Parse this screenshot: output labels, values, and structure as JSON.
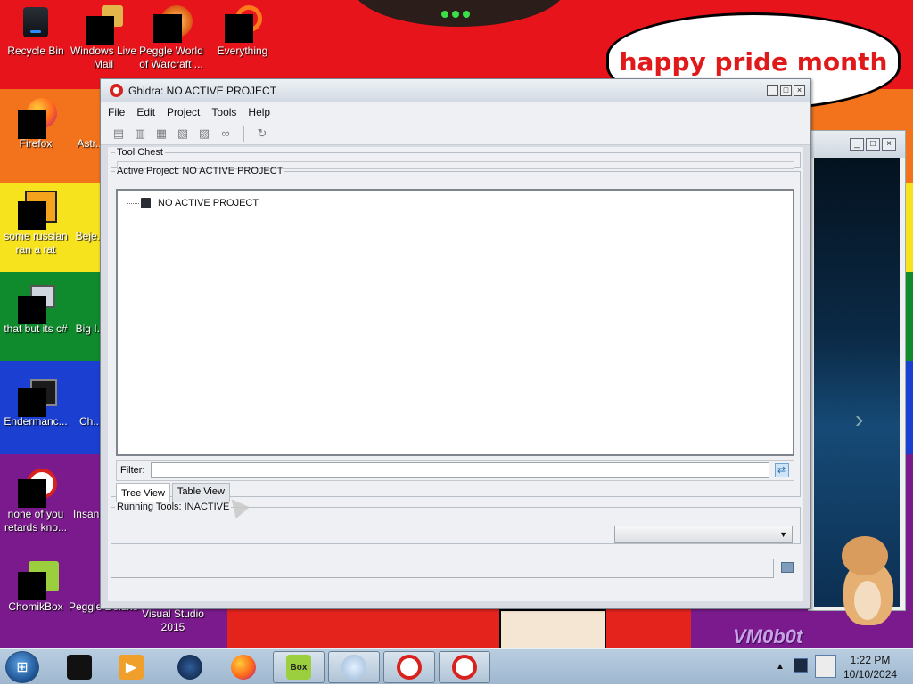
{
  "desktop": {
    "speech_bubble": "happy pride month",
    "watermark": "VM0b0t",
    "icons": [
      {
        "label": "Recycle Bin",
        "glyph": "recycle-bin-icon"
      },
      {
        "label": "Windows Live Mail",
        "glyph": "mail-icon"
      },
      {
        "label": "Peggle World of Warcraft ...",
        "glyph": "peggle-icon"
      },
      {
        "label": "Everything",
        "glyph": "search-icon"
      },
      {
        "label": "Firefox",
        "glyph": "firefox-icon"
      },
      {
        "label": "Astr... De...",
        "glyph": "game-icon"
      },
      {
        "label": "some russian ran a rat",
        "glyph": "app-icon"
      },
      {
        "label": "Beje... De...",
        "glyph": "game-icon"
      },
      {
        "label": "that but its c#",
        "glyph": "app-icon"
      },
      {
        "label": "Big I... De...",
        "glyph": "game-icon"
      },
      {
        "label": "Endermanc...",
        "glyph": "terminal-icon"
      },
      {
        "label": "Ch... De...",
        "glyph": "game-icon"
      },
      {
        "label": "none of you retards kno...",
        "glyph": "ghidra-icon"
      },
      {
        "label": "Insan... De...",
        "glyph": "game-icon"
      },
      {
        "label": "ChomikBox",
        "glyph": "chomikbox-icon"
      },
      {
        "label": "Peggle Deluxe",
        "glyph": "peggle-icon"
      },
      {
        "label": "Visual Studio 2015",
        "glyph": "visual-studio-icon"
      }
    ]
  },
  "window": {
    "title": "Ghidra: NO ACTIVE PROJECT",
    "menus": [
      "File",
      "Edit",
      "Project",
      "Tools",
      "Help"
    ],
    "tool_chest_label": "Tool Chest",
    "active_project_label": "Active Project: NO ACTIVE PROJECT",
    "tree_root": "NO ACTIVE PROJECT",
    "filter_label": "Filter:",
    "filter_value": "",
    "tabs": [
      {
        "label": "Tree View",
        "active": true
      },
      {
        "label": "Table View",
        "active": false
      }
    ],
    "running_tools_label": "Running Tools: INACTIVE",
    "running_tools_value": ""
  },
  "taskbar": {
    "items": [
      {
        "name": "explorer-icon"
      },
      {
        "name": "media-player-icon"
      },
      {
        "name": "globe-icon"
      },
      {
        "name": "firefox-icon"
      },
      {
        "name": "chomikbox-icon",
        "label": "Box"
      },
      {
        "name": "windows-flag-icon"
      },
      {
        "name": "ghidra-icon"
      },
      {
        "name": "ghidra-icon"
      }
    ],
    "clock_time": "1:22 PM",
    "clock_date": "10/10/2024"
  },
  "colors": {
    "accent": "#d8221e",
    "bubble_text": "#e01a1a"
  }
}
